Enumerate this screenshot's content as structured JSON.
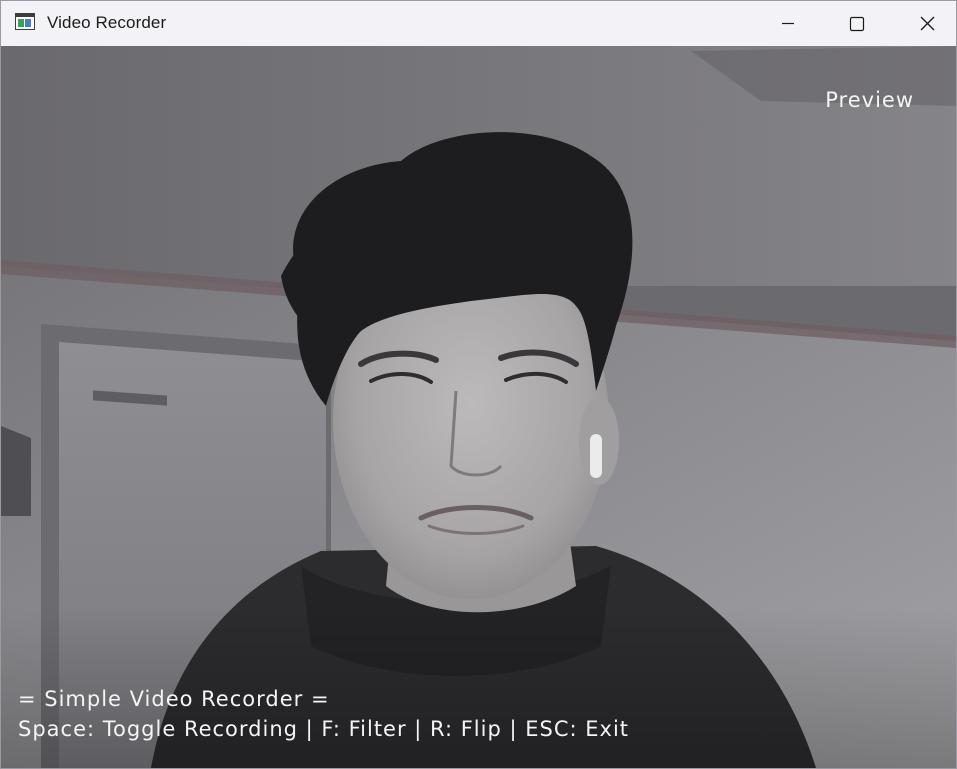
{
  "window": {
    "title": "Video Recorder",
    "app_icon": "app-window-icon",
    "controls": {
      "minimize_icon": "minimize-icon",
      "maximize_icon": "maximize-icon",
      "close_icon": "close-icon"
    }
  },
  "video": {
    "mode_label": "Preview",
    "app_heading": "= Simple Video Recorder =",
    "shortcuts": "Space: Toggle Recording | F: Filter | R: Flip | ESC: Exit"
  },
  "colors": {
    "titlebar_bg": "#f3f2f7",
    "overlay_text": "#f4f4f4"
  }
}
